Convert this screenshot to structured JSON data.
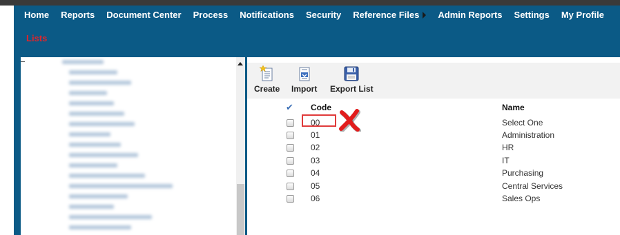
{
  "nav": {
    "items": [
      {
        "label": "Home"
      },
      {
        "label": "Reports"
      },
      {
        "label": "Document Center"
      },
      {
        "label": "Process"
      },
      {
        "label": "Notifications"
      },
      {
        "label": "Security"
      },
      {
        "label": "Reference Files",
        "has_submenu": true
      },
      {
        "label": "Admin Reports"
      },
      {
        "label": "Settings"
      },
      {
        "label": "My Profile"
      }
    ],
    "sublink": "Lists"
  },
  "toolbar": {
    "create_label": "Create",
    "import_label": "Import",
    "export_label": "Export List"
  },
  "grid": {
    "headers": {
      "code": "Code",
      "name": "Name"
    },
    "rows": [
      {
        "code": "00",
        "name": "Select One"
      },
      {
        "code": "01",
        "name": "Administration"
      },
      {
        "code": "02",
        "name": "HR"
      },
      {
        "code": "03",
        "name": "IT"
      },
      {
        "code": "04",
        "name": "Purchasing"
      },
      {
        "code": "05",
        "name": "Central Services"
      },
      {
        "code": "06",
        "name": "Sales Ops"
      }
    ]
  },
  "colors": {
    "header_bg": "#0b5a86",
    "sublink": "#e0242a",
    "annotation": "#e03a3a"
  }
}
